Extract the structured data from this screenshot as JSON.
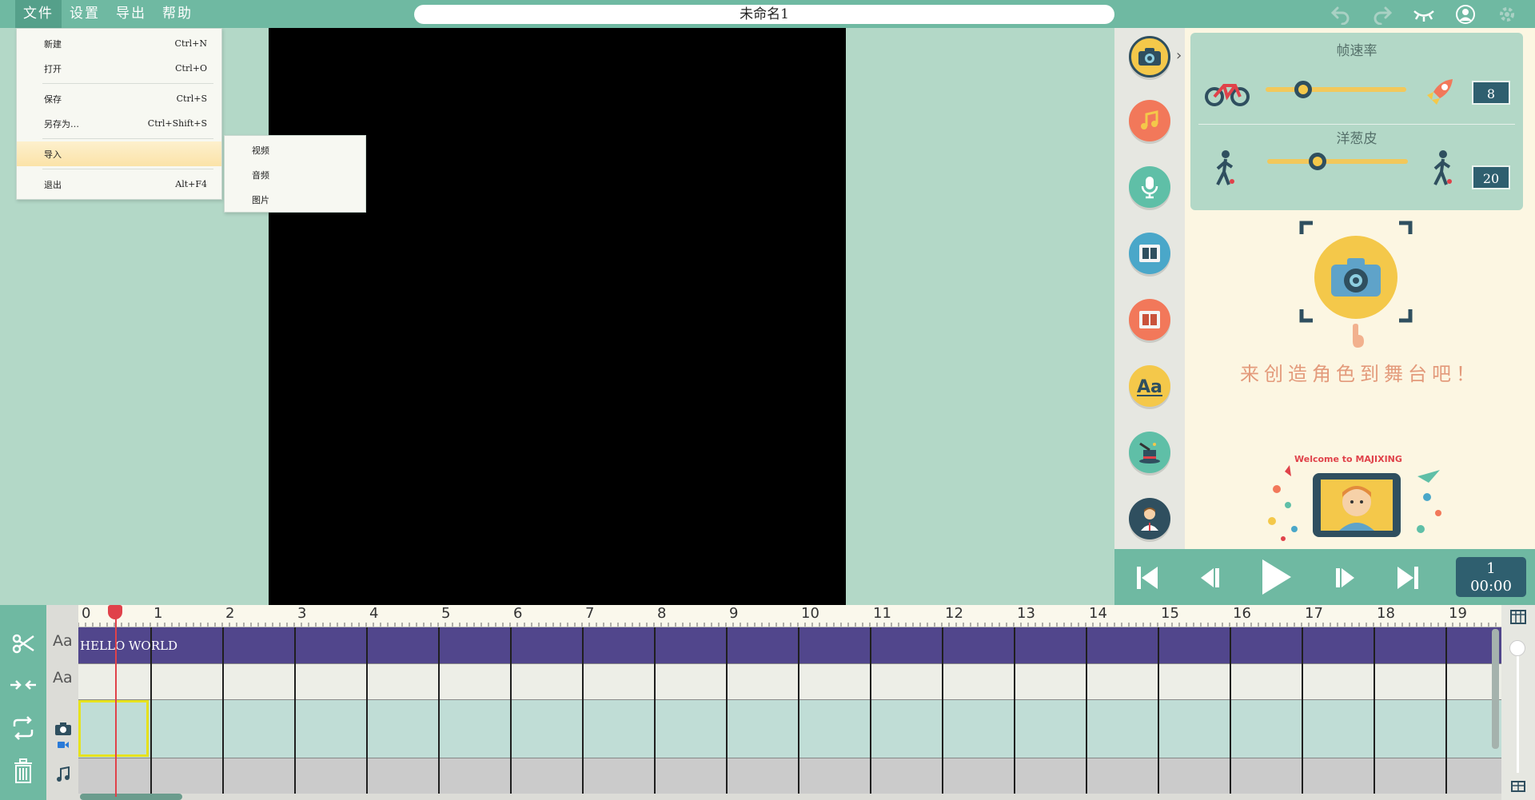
{
  "menu": {
    "file": "文件",
    "settings": "设置",
    "export": "导出",
    "help": "帮助"
  },
  "title": "未命名1",
  "file_menu": {
    "new": {
      "label": "新建",
      "shortcut": "Ctrl+N"
    },
    "open": {
      "label": "打开",
      "shortcut": "Ctrl+O"
    },
    "save": {
      "label": "保存",
      "shortcut": "Ctrl+S"
    },
    "save_as": {
      "label": "另存为…",
      "shortcut": "Ctrl+Shift+S"
    },
    "import": {
      "label": "导入"
    },
    "exit": {
      "label": "退出",
      "shortcut": "Alt+F4"
    }
  },
  "import_submenu": {
    "video": "视频",
    "audio": "音频",
    "image": "图片"
  },
  "top_icons": [
    "undo-icon",
    "redo-icon",
    "eye-closed-icon",
    "user-icon",
    "settings-icon"
  ],
  "sidebar": [
    "camera-icon",
    "music-icon",
    "microphone-icon",
    "film-strip-icon",
    "film-strip-red-icon",
    "text-icon",
    "magic-hat-icon",
    "character-icon"
  ],
  "settings": {
    "frame_rate": {
      "label": "帧速率",
      "value": "8",
      "level": 0.25
    },
    "onion_skin": {
      "label": "洋葱皮",
      "value": "20",
      "level": 0.35
    }
  },
  "hint": "来创造角色到舞台吧！",
  "welcome": "Welcome to MAJIXING",
  "playback": {
    "frame": "1",
    "time": "00:00"
  },
  "timeline": {
    "ticks": [
      "0",
      "1",
      "2",
      "3",
      "4",
      "5",
      "6",
      "7",
      "8",
      "9",
      "10",
      "11",
      "12",
      "13",
      "14",
      "15",
      "16",
      "17",
      "18",
      "19"
    ],
    "text_clip": "HELLO WORLD",
    "track_labels": {
      "text1": "Aa",
      "text2": "Aa"
    }
  },
  "colors": {
    "accent": "#6fb9a2",
    "stage": "#000000",
    "text_track": "#51468c",
    "playhead": "#e0424a",
    "hint": "#e39a7b"
  }
}
